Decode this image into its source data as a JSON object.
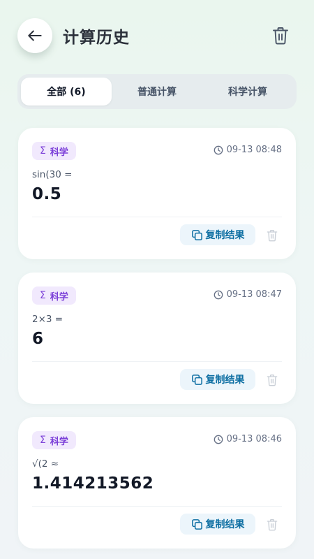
{
  "header": {
    "title": "计算历史",
    "back_icon": "arrow-left-icon",
    "clear_icon": "trash-icon"
  },
  "tabs": [
    {
      "label": "全部 (6)",
      "active": true
    },
    {
      "label": "普通计算",
      "active": false
    },
    {
      "label": "科学计算",
      "active": false
    }
  ],
  "history": [
    {
      "type_label": "科学",
      "type_icon": "Σ",
      "time": "09-13 08:48",
      "expression": "sin(30 =",
      "result": "0.5",
      "copy_label": "复制结果"
    },
    {
      "type_label": "科学",
      "type_icon": "Σ",
      "time": "09-13 08:47",
      "expression": "2×3 =",
      "result": "6",
      "copy_label": "复制结果"
    },
    {
      "type_label": "科学",
      "type_icon": "Σ",
      "time": "09-13 08:46",
      "expression": "√(2 ≈",
      "result": "1.414213562",
      "copy_label": "复制结果"
    }
  ],
  "colors": {
    "badge_bg": "#f1e9fd",
    "badge_text": "#7b3fd8",
    "copy_bg": "#ecf5fb",
    "copy_text": "#0e6fa3"
  }
}
